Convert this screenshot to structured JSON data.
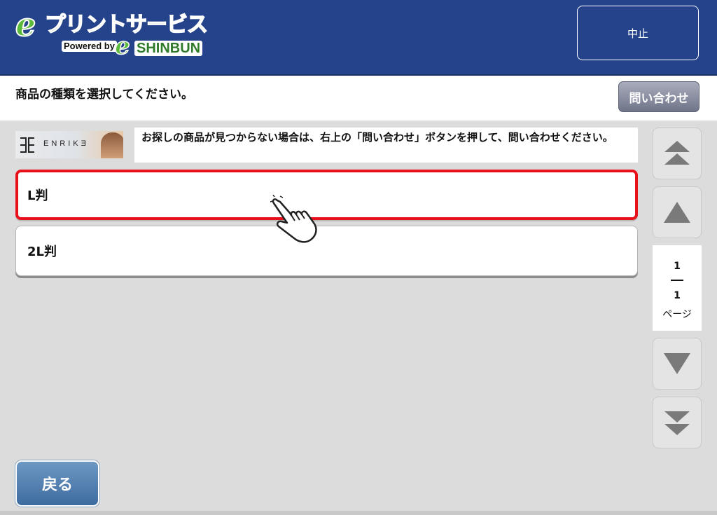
{
  "header": {
    "logo": {
      "e_letter": "e",
      "title": "プリントサービス",
      "powered_by": "Powered by",
      "e_letter_small": "e",
      "brand": "SHINBUN"
    },
    "stop_label": "中止",
    "background_color": "#25438a"
  },
  "subheader": {
    "instruction": "商品の種類を選択してください。",
    "inquiry_label": "問い合わせ"
  },
  "banner": {
    "brand_text": "ENRIKƎ"
  },
  "notice": "お探しの商品が見つからない場合は、右上の「問い合わせ」ボタンを押して、問い合わせください。",
  "options": [
    {
      "label": "L判",
      "selected": true
    },
    {
      "label": "2L判",
      "selected": false
    }
  ],
  "pager": {
    "first_icon": "double-up-triangle-icon",
    "prev_icon": "up-triangle-icon",
    "next_icon": "down-triangle-icon",
    "last_icon": "double-down-triangle-icon",
    "current_page": "1",
    "total_pages": "1",
    "page_label": "ページ"
  },
  "back_label": "戻る",
  "colors": {
    "selected_border": "#e8101a",
    "accent_green": "#2f7b2a",
    "back_button": "#4d7bae"
  }
}
